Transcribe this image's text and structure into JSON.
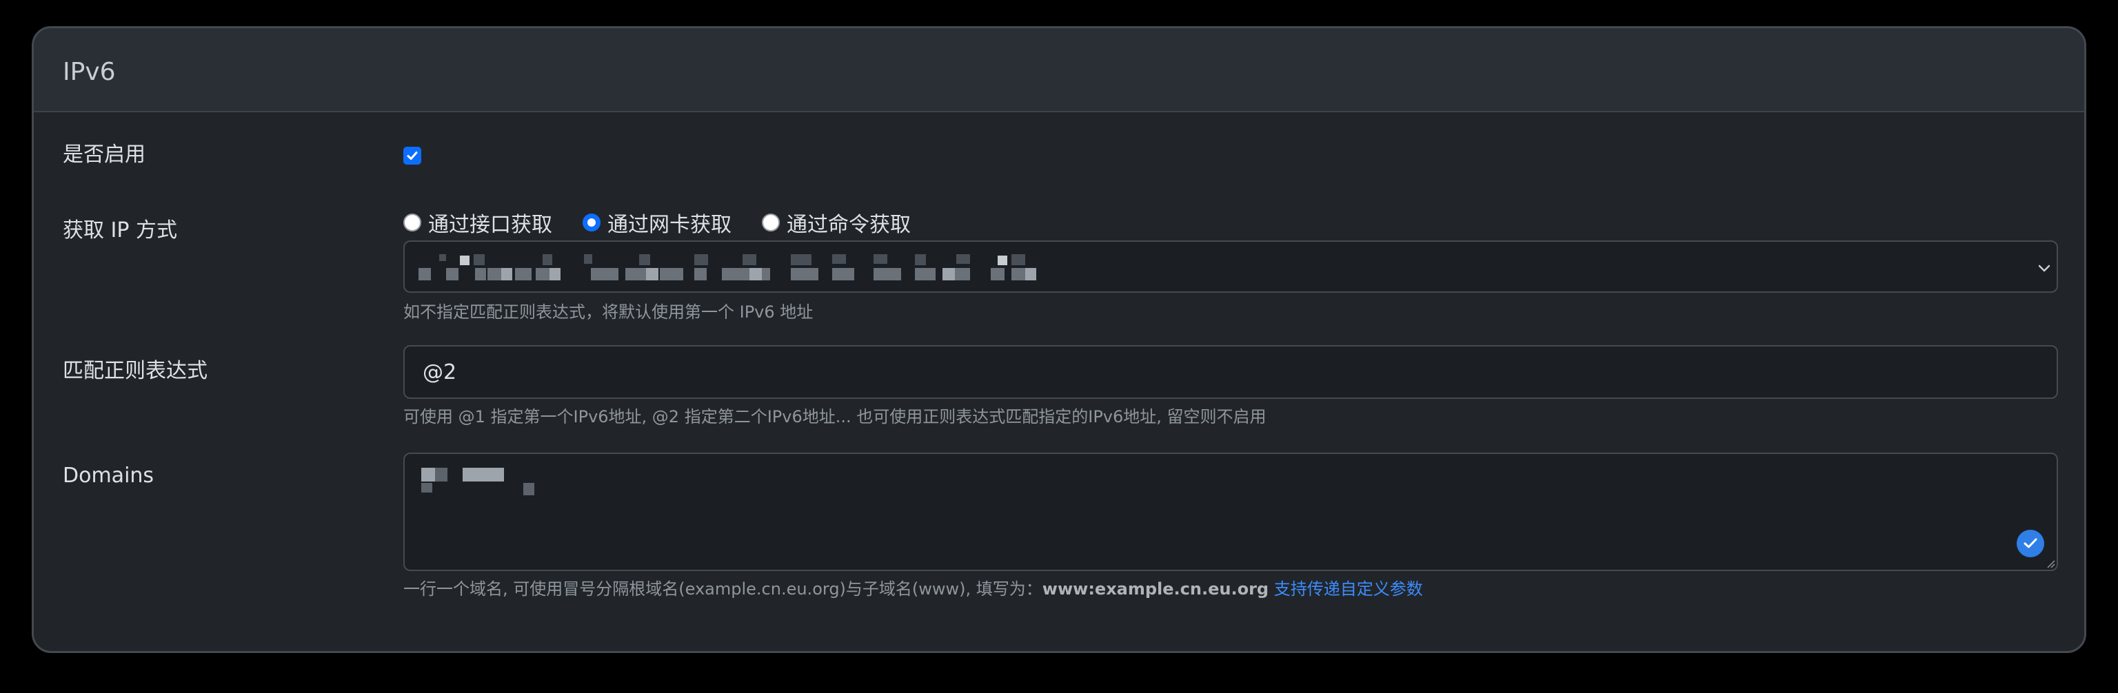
{
  "card": {
    "title": "IPv6"
  },
  "enable": {
    "label": "是否启用",
    "checked": true
  },
  "ip_method": {
    "label": "获取 IP 方式",
    "options": [
      {
        "label": "通过接口获取",
        "checked": false
      },
      {
        "label": "通过网卡获取",
        "checked": true
      },
      {
        "label": "通过命令获取",
        "checked": false
      }
    ],
    "select_value": "",
    "select_value_redacted": true,
    "help": "如不指定匹配正则表达式，将默认使用第一个 IPv6 地址"
  },
  "regex": {
    "label": "匹配正则表达式",
    "value": "@2",
    "help": "可使用 @1 指定第一个IPv6地址, @2 指定第二个IPv6地址... 也可使用正则表达式匹配指定的IPv6地址, 留空则不启用"
  },
  "domains": {
    "label": "Domains",
    "value_redacted": true,
    "help_prefix": "一行一个域名, 可使用冒号分隔根域名(example.cn.eu.org)与子域名(www), 填写为：",
    "help_example": "www:example.cn.eu.org",
    "help_link": "支持传递自定义参数"
  },
  "colors": {
    "accent": "#0d6efd",
    "link": "#3d8bfd",
    "card_bg": "#212529",
    "page_bg": "#000000"
  }
}
